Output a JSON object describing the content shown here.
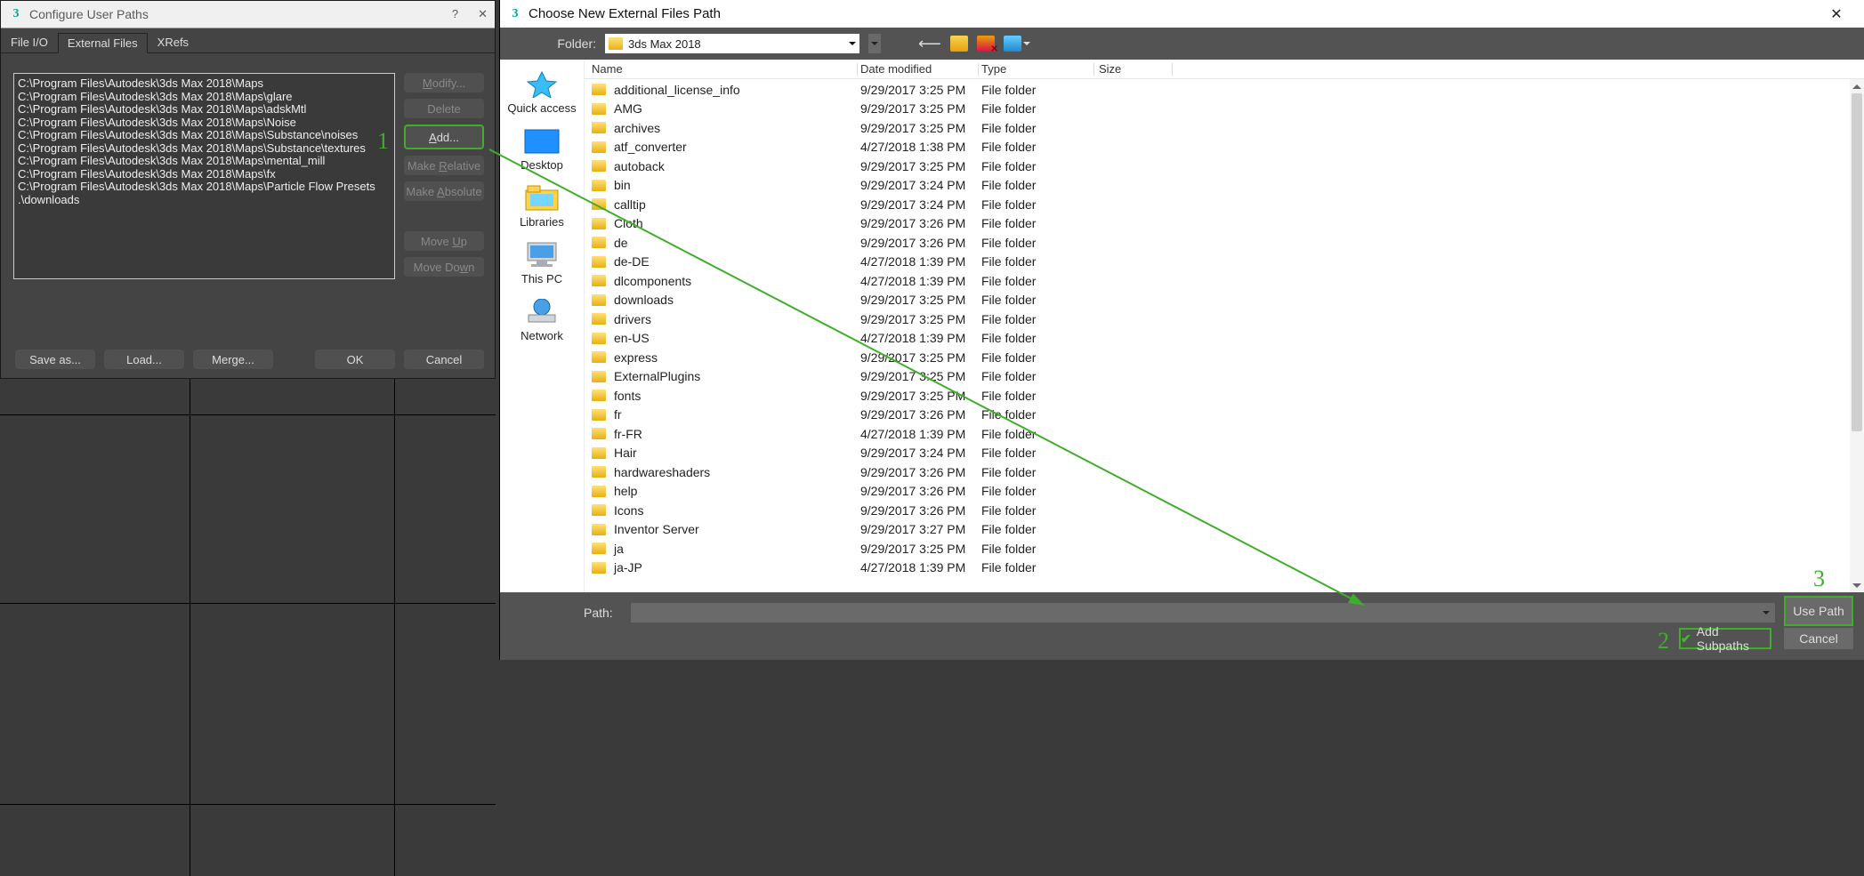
{
  "left": {
    "title": "Configure User Paths",
    "tabs": {
      "fileio": "File I/O",
      "external": "External Files",
      "xrefs": "XRefs"
    },
    "paths": [
      "C:\\Program Files\\Autodesk\\3ds Max 2018\\Maps",
      "C:\\Program Files\\Autodesk\\3ds Max 2018\\Maps\\glare",
      "C:\\Program Files\\Autodesk\\3ds Max 2018\\Maps\\adskMtl",
      "C:\\Program Files\\Autodesk\\3ds Max 2018\\Maps\\Noise",
      "C:\\Program Files\\Autodesk\\3ds Max 2018\\Maps\\Substance\\noises",
      "C:\\Program Files\\Autodesk\\3ds Max 2018\\Maps\\Substance\\textures",
      "C:\\Program Files\\Autodesk\\3ds Max 2018\\Maps\\mental_mill",
      "C:\\Program Files\\Autodesk\\3ds Max 2018\\Maps\\fx",
      "C:\\Program Files\\Autodesk\\3ds Max 2018\\Maps\\Particle Flow Presets",
      ".\\downloads"
    ],
    "buttons": {
      "modify": "Modify...",
      "delete": "Delete",
      "add": "Add...",
      "make_relative": "Make Relative",
      "make_absolute": "Make Absolute",
      "move_up": "Move Up",
      "move_down": "Move Down",
      "save_as": "Save as...",
      "load": "Load...",
      "merge": "Merge...",
      "ok": "OK",
      "cancel": "Cancel"
    }
  },
  "right": {
    "title": "Choose New External Files Path",
    "folder_label": "Folder:",
    "folder_value": "3ds Max 2018",
    "columns": {
      "name": "Name",
      "date": "Date modified",
      "type": "Type",
      "size": "Size"
    },
    "places": {
      "quick_access": "Quick access",
      "desktop": "Desktop",
      "libraries": "Libraries",
      "this_pc": "This PC",
      "network": "Network"
    },
    "rows": [
      {
        "name": "additional_license_info",
        "date": "9/29/2017 3:25 PM",
        "type": "File folder"
      },
      {
        "name": "AMG",
        "date": "9/29/2017 3:25 PM",
        "type": "File folder"
      },
      {
        "name": "archives",
        "date": "9/29/2017 3:25 PM",
        "type": "File folder"
      },
      {
        "name": "atf_converter",
        "date": "4/27/2018 1:38 PM",
        "type": "File folder"
      },
      {
        "name": "autoback",
        "date": "9/29/2017 3:25 PM",
        "type": "File folder"
      },
      {
        "name": "bin",
        "date": "9/29/2017 3:24 PM",
        "type": "File folder"
      },
      {
        "name": "calltip",
        "date": "9/29/2017 3:24 PM",
        "type": "File folder"
      },
      {
        "name": "Cloth",
        "date": "9/29/2017 3:26 PM",
        "type": "File folder"
      },
      {
        "name": "de",
        "date": "9/29/2017 3:26 PM",
        "type": "File folder"
      },
      {
        "name": "de-DE",
        "date": "4/27/2018 1:39 PM",
        "type": "File folder"
      },
      {
        "name": "dlcomponents",
        "date": "4/27/2018 1:39 PM",
        "type": "File folder"
      },
      {
        "name": "downloads",
        "date": "9/29/2017 3:25 PM",
        "type": "File folder"
      },
      {
        "name": "drivers",
        "date": "9/29/2017 3:25 PM",
        "type": "File folder"
      },
      {
        "name": "en-US",
        "date": "4/27/2018 1:39 PM",
        "type": "File folder"
      },
      {
        "name": "express",
        "date": "9/29/2017 3:25 PM",
        "type": "File folder"
      },
      {
        "name": "ExternalPlugins",
        "date": "9/29/2017 3:25 PM",
        "type": "File folder"
      },
      {
        "name": "fonts",
        "date": "9/29/2017 3:25 PM",
        "type": "File folder"
      },
      {
        "name": "fr",
        "date": "9/29/2017 3:26 PM",
        "type": "File folder"
      },
      {
        "name": "fr-FR",
        "date": "4/27/2018 1:39 PM",
        "type": "File folder"
      },
      {
        "name": "Hair",
        "date": "9/29/2017 3:24 PM",
        "type": "File folder"
      },
      {
        "name": "hardwareshaders",
        "date": "9/29/2017 3:26 PM",
        "type": "File folder"
      },
      {
        "name": "help",
        "date": "9/29/2017 3:26 PM",
        "type": "File folder"
      },
      {
        "name": "Icons",
        "date": "9/29/2017 3:26 PM",
        "type": "File folder"
      },
      {
        "name": "Inventor Server",
        "date": "9/29/2017 3:27 PM",
        "type": "File folder"
      },
      {
        "name": "ja",
        "date": "9/29/2017 3:25 PM",
        "type": "File folder"
      },
      {
        "name": "ja-JP",
        "date": "4/27/2018 1:39 PM",
        "type": "File folder"
      }
    ],
    "path_label": "Path:",
    "use_path": "Use Path",
    "add_subpaths": "Add Subpaths",
    "cancel": "Cancel"
  },
  "annotations": {
    "one": "1",
    "two": "2",
    "three": "3"
  }
}
